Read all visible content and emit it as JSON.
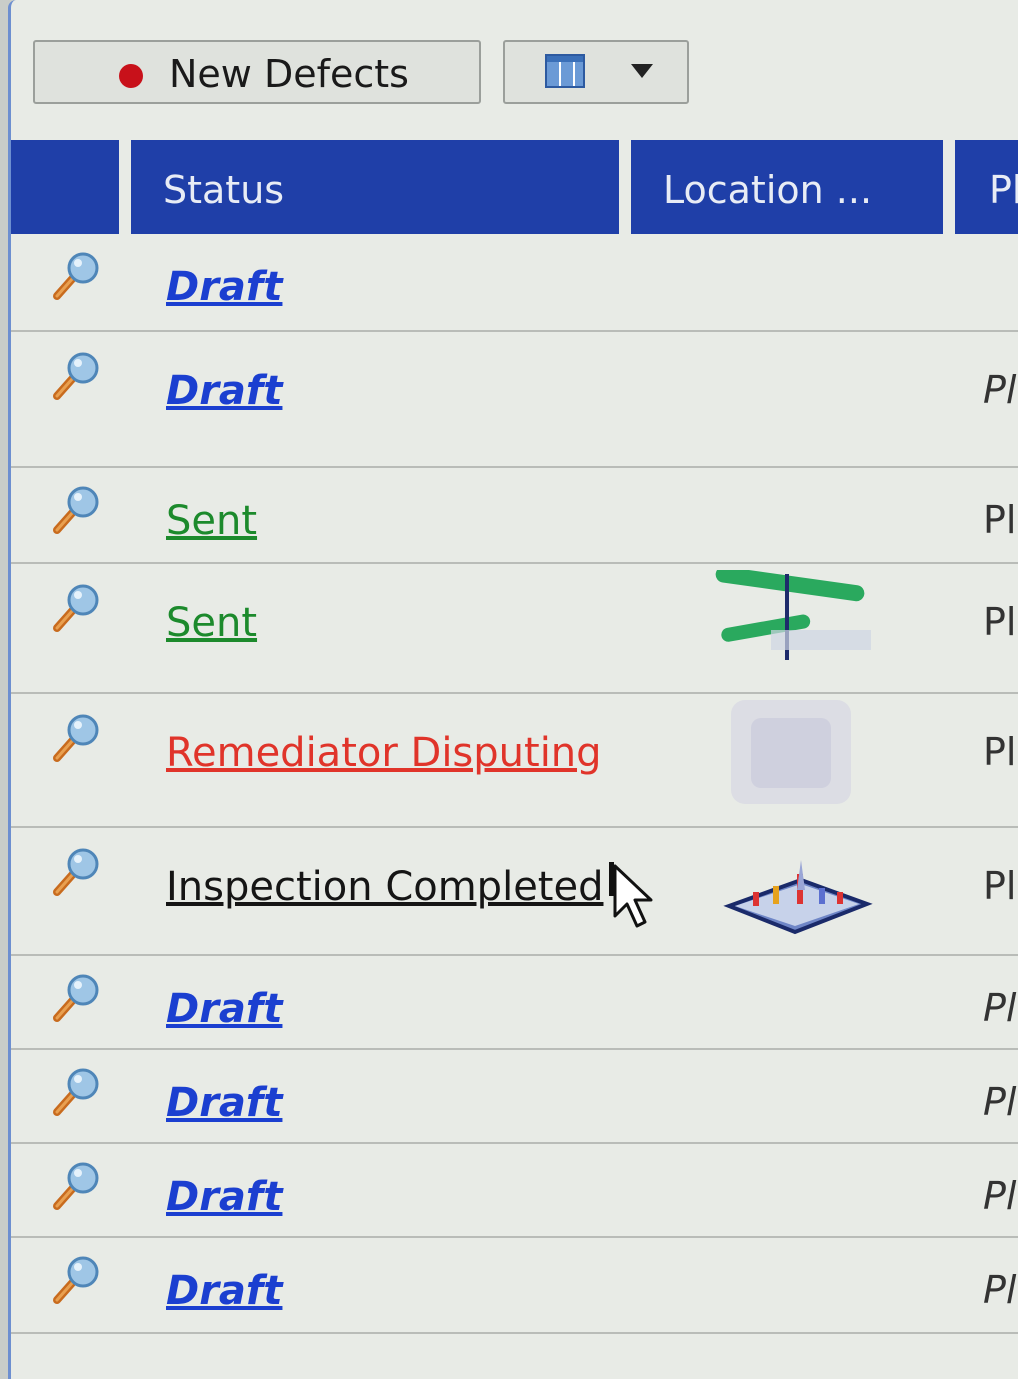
{
  "toolbar": {
    "new_defects_label": "New Defects",
    "status_dot_color": "#c8111a",
    "view_icon": "grid-view-icon",
    "dropdown_icon": "caret-down-icon"
  },
  "columns": {
    "status": "Status",
    "location": "Location ...",
    "plan": "Pl"
  },
  "rows": [
    {
      "status": "Draft",
      "kind": "draft",
      "plan": ""
    },
    {
      "status": "Draft",
      "kind": "draft",
      "plan": "Pl"
    },
    {
      "status": "Sent",
      "kind": "sent",
      "plan": "Pl"
    },
    {
      "status": "Sent",
      "kind": "sent",
      "plan": "Pl",
      "thumbnail": "plan-thumbnail-icon"
    },
    {
      "status": "Remediator Disputing",
      "kind": "disputing",
      "plan": "Pl",
      "thumbnail": "blurred-thumbnail-icon"
    },
    {
      "status": "Inspection Completed",
      "kind": "completed",
      "plan": "Pl",
      "thumbnail": "3d-model-thumbnail-icon"
    },
    {
      "status": "Draft",
      "kind": "draft",
      "plan": "Pl"
    },
    {
      "status": "Draft",
      "kind": "draft",
      "plan": "Pl"
    },
    {
      "status": "Draft",
      "kind": "draft",
      "plan": "Pl"
    },
    {
      "status": "Draft",
      "kind": "draft",
      "plan": "Pl"
    }
  ],
  "colors": {
    "header_bg": "#1f3fa8",
    "draft": "#1b3fd0",
    "sent": "#1c8a2c",
    "disputing": "#e0342a",
    "completed": "#151515"
  }
}
